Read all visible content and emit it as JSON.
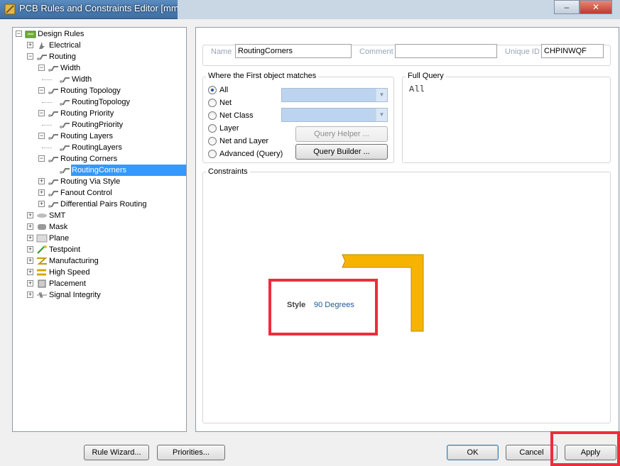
{
  "window": {
    "title": "PCB Rules and Constraints Editor [mm]",
    "minimize_glyph": "–",
    "close_glyph": "✕"
  },
  "tree": {
    "items": [
      {
        "id": "design-rules",
        "label": "Design Rules",
        "level": 0,
        "expander": "−",
        "icon": "design-rules-icon"
      },
      {
        "id": "electrical",
        "label": "Electrical",
        "level": 1,
        "expander": "+",
        "icon": "electrical-icon"
      },
      {
        "id": "routing",
        "label": "Routing",
        "level": 1,
        "expander": "−",
        "icon": "routing-icon"
      },
      {
        "id": "width",
        "label": "Width",
        "level": 2,
        "expander": "−",
        "icon": "rule-icon"
      },
      {
        "id": "width-rule",
        "label": "Width",
        "level": 3,
        "expander": "",
        "icon": "rule-icon"
      },
      {
        "id": "routing-topology",
        "label": "Routing Topology",
        "level": 2,
        "expander": "−",
        "icon": "rule-icon"
      },
      {
        "id": "routing-topology-rule",
        "label": "RoutingTopology",
        "level": 3,
        "expander": "",
        "icon": "rule-icon"
      },
      {
        "id": "routing-priority",
        "label": "Routing Priority",
        "level": 2,
        "expander": "−",
        "icon": "rule-icon"
      },
      {
        "id": "routing-priority-rule",
        "label": "RoutingPriority",
        "level": 3,
        "expander": "",
        "icon": "rule-icon"
      },
      {
        "id": "routing-layers",
        "label": "Routing Layers",
        "level": 2,
        "expander": "−",
        "icon": "rule-icon"
      },
      {
        "id": "routing-layers-rule",
        "label": "RoutingLayers",
        "level": 3,
        "expander": "",
        "icon": "rule-icon"
      },
      {
        "id": "routing-corners",
        "label": "Routing Corners",
        "level": 2,
        "expander": "−",
        "icon": "rule-icon"
      },
      {
        "id": "routing-corners-rule",
        "label": "RoutingCorners",
        "level": 3,
        "expander": "",
        "icon": "rule-icon",
        "selected": true
      },
      {
        "id": "routing-via-style",
        "label": "Routing Via Style",
        "level": 2,
        "expander": "+",
        "icon": "rule-icon"
      },
      {
        "id": "fanout-control",
        "label": "Fanout Control",
        "level": 2,
        "expander": "+",
        "icon": "rule-icon"
      },
      {
        "id": "differential-pairs-routing",
        "label": "Differential Pairs Routing",
        "level": 2,
        "expander": "+",
        "icon": "rule-icon"
      },
      {
        "id": "smt",
        "label": "SMT",
        "level": 1,
        "expander": "+",
        "icon": "smt-icon"
      },
      {
        "id": "mask",
        "label": "Mask",
        "level": 1,
        "expander": "+",
        "icon": "mask-icon"
      },
      {
        "id": "plane",
        "label": "Plane",
        "level": 1,
        "expander": "+",
        "icon": "plane-icon"
      },
      {
        "id": "testpoint",
        "label": "Testpoint",
        "level": 1,
        "expander": "+",
        "icon": "testpoint-icon"
      },
      {
        "id": "manufacturing",
        "label": "Manufacturing",
        "level": 1,
        "expander": "+",
        "icon": "manufacturing-icon"
      },
      {
        "id": "high-speed",
        "label": "High Speed",
        "level": 1,
        "expander": "+",
        "icon": "high-speed-icon"
      },
      {
        "id": "placement",
        "label": "Placement",
        "level": 1,
        "expander": "+",
        "icon": "placement-icon"
      },
      {
        "id": "signal-integrity",
        "label": "Signal Integrity",
        "level": 1,
        "expander": "+",
        "icon": "signal-integrity-icon"
      }
    ]
  },
  "header_fields": {
    "name_label": "Name",
    "name_value": "RoutingCorners",
    "comment_label": "Comment",
    "comment_value": "",
    "unique_id_label": "Unique ID",
    "unique_id_value": "CHPINWQF"
  },
  "match_group": {
    "title": "Where the First object matches",
    "options": [
      "All",
      "Net",
      "Net Class",
      "Layer",
      "Net and Layer",
      "Advanced (Query)"
    ],
    "selected": "All",
    "query_helper_label": "Query Helper ...",
    "query_builder_label": "Query Builder ..."
  },
  "full_query": {
    "title": "Full Query",
    "text": "All"
  },
  "constraints": {
    "title": "Constraints",
    "style_label": "Style",
    "style_value": "90 Degrees",
    "trace_color": "#f6b400"
  },
  "footer": {
    "rule_wizard_label": "Rule Wizard...",
    "priorities_label": "Priorities...",
    "ok_label": "OK",
    "cancel_label": "Cancel",
    "apply_label": "Apply"
  },
  "colors": {
    "highlight": "#ee2c3c",
    "selection": "#3399ff"
  }
}
